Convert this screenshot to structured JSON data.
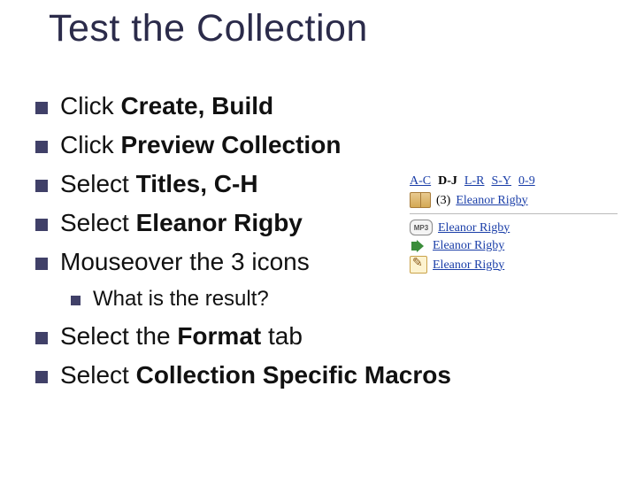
{
  "title": "Test the Collection",
  "bullets": {
    "b1_prefix": "Click ",
    "b1_bold": "Create, Build",
    "b2_prefix": "Click ",
    "b2_bold": "Preview Collection",
    "b3_prefix": "Select ",
    "b3_bold": "Titles,  C-H",
    "b4_prefix": "Select ",
    "b4_bold": "Eleanor Rigby",
    "b5": "Mouseover the 3 icons",
    "b5a": "What is the result?",
    "b6_prefix": "Select the ",
    "b6_bold": "Format",
    "b6_suffix": " tab",
    "b7_prefix": "Select  ",
    "b7_bold": "Collection Specific Macros"
  },
  "mini": {
    "tabs": [
      "A-C",
      "D-J",
      "L-R",
      "S-Y",
      "0-9"
    ],
    "active_tab_index": 1,
    "main_entry_index": "(3)",
    "entry_title": "Eleanor Rigby",
    "mp3_label": "MP3",
    "rows": [
      "Eleanor Rigby",
      "Eleanor Rigby",
      "Eleanor Rigby"
    ]
  }
}
